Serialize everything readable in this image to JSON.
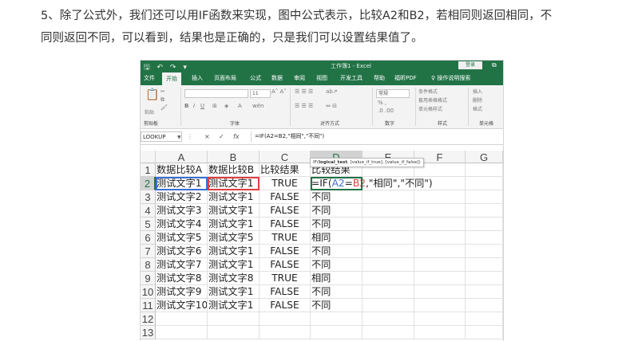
{
  "article": {
    "line1": "5、除了公式外，我们还可以用IF函数来实现，图中公式表示，比较A2和B2，若相同则返回相同，不",
    "line2": "同则返回不同，可以看到，结果也是正确的，只是我们可以设置结果值了。"
  },
  "excel": {
    "window_title": "工作簿1 - Excel",
    "sign_in": "登录",
    "tabs": [
      "文件",
      "开始",
      "插入",
      "页面布局",
      "公式",
      "数据",
      "审阅",
      "视图",
      "开发工具",
      "帮助",
      "福昕PDF"
    ],
    "active_tab": "开始",
    "tell_me": "操作说明搜索",
    "ribbon_groups": [
      "剪贴板",
      "字体",
      "对齐方式",
      "数字",
      "样式",
      "单元格"
    ],
    "ribbon_paste": "粘贴",
    "ribbon_font_size": "11",
    "ribbon_number_format": "常规",
    "ribbon_styles": [
      "条件格式",
      "套用表格格式",
      "单元格样式"
    ],
    "ribbon_cells": [
      "插入",
      "删除",
      "格式"
    ],
    "name_box": "LOOKUP",
    "formula_cancel": "×",
    "formula_enter": "✓",
    "formula_fx": "fx",
    "formula": "=IF(A2=B2,\"相同\",\"不同\")",
    "columns": [
      "A",
      "B",
      "C",
      "D",
      "E",
      "F",
      "G"
    ],
    "active_column": "D",
    "active_row": "2",
    "rows": [
      {
        "num": "1",
        "a": "数据比较A",
        "b": "数据比较B",
        "c": "比较结果",
        "d": "比较结果"
      },
      {
        "num": "2",
        "a": "测试文字1",
        "b": "测试文字1",
        "c": "TRUE",
        "d": ""
      },
      {
        "num": "3",
        "a": "测试文字2",
        "b": "测试文字1",
        "c": "FALSE",
        "d": "不同"
      },
      {
        "num": "4",
        "a": "测试文字3",
        "b": "测试文字1",
        "c": "FALSE",
        "d": "不同"
      },
      {
        "num": "5",
        "a": "测试文字4",
        "b": "测试文字1",
        "c": "FALSE",
        "d": "不同"
      },
      {
        "num": "6",
        "a": "测试文字5",
        "b": "测试文字5",
        "c": "TRUE",
        "d": "相同"
      },
      {
        "num": "7",
        "a": "测试文字6",
        "b": "测试文字1",
        "c": "FALSE",
        "d": "不同"
      },
      {
        "num": "8",
        "a": "测试文字7",
        "b": "测试文字1",
        "c": "FALSE",
        "d": "不同"
      },
      {
        "num": "9",
        "a": "测试文字8",
        "b": "测试文字8",
        "c": "TRUE",
        "d": "相同"
      },
      {
        "num": "10",
        "a": "测试文字9",
        "b": "测试文字1",
        "c": "FALSE",
        "d": "不同"
      },
      {
        "num": "11",
        "a": "测试文字10",
        "b": "测试文字1",
        "c": "FALSE",
        "d": "不同"
      },
      {
        "num": "12",
        "a": "",
        "b": "",
        "c": "",
        "d": ""
      },
      {
        "num": "13",
        "a": "",
        "b": "",
        "c": "",
        "d": ""
      }
    ],
    "editing_formula_parts": [
      "=IF(",
      "A2",
      "=",
      "B2",
      ",\"相同\",\"不同\")"
    ],
    "tooltip_parts": [
      "IF(",
      "logical_test",
      ", [value_if_true], [value_if_false])"
    ],
    "colors": {
      "excel_green": "#217346",
      "ref_blue": "#3b6fd1",
      "ref_red": "#e03e3e"
    }
  }
}
